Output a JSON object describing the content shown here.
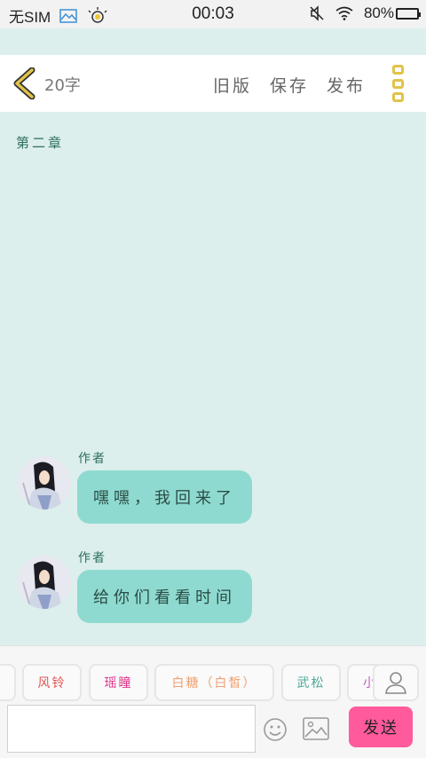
{
  "status_bar": {
    "carrier": "无SIM",
    "time": "00:03",
    "battery": "80%",
    "battery_level": 0.8
  },
  "header": {
    "word_count": "20字",
    "actions": [
      "旧版",
      "保存",
      "发布"
    ]
  },
  "content": {
    "chapter": "第二章",
    "messages": [
      {
        "author": "作者",
        "text": "嘿嘿，我回来了"
      },
      {
        "author": "作者",
        "text": "给你们看看时间"
      }
    ]
  },
  "roles": [
    {
      "label": "",
      "color": "#c9a08a"
    },
    {
      "label": "风铃",
      "color": "#e05555"
    },
    {
      "label": "瑶瞳",
      "color": "#e0338a"
    },
    {
      "label": "白糖（白皙）",
      "color": "#f0a070"
    },
    {
      "label": "武松",
      "color": "#4fa89a"
    },
    {
      "label": "小",
      "color": "#c060c0"
    }
  ],
  "composer": {
    "input_value": "",
    "send_label": "发送"
  },
  "colors": {
    "background": "#dcefec",
    "bubble": "#8fdad0",
    "send": "#ff5a9c",
    "accent": "#e1c34b"
  }
}
